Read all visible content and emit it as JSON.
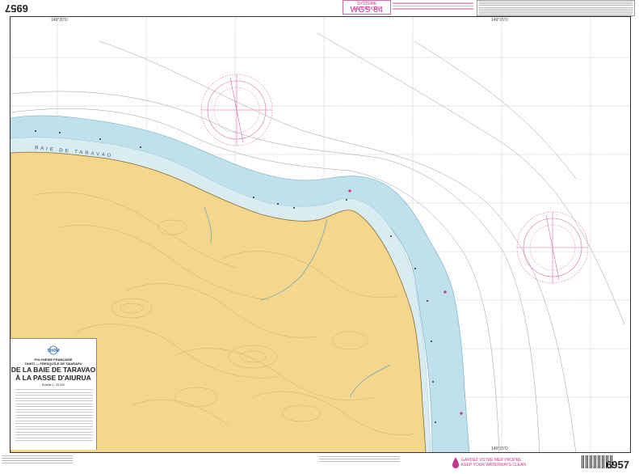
{
  "sheet_number": "6957",
  "datum": {
    "small": "SYSTÈME GÉODÉSIQUE",
    "big": "WGS 84"
  },
  "title": {
    "region": "POLYNÉSIE FRANÇAISE\nTAHITI — PRESQU'ÎLE DE TAIARAPU",
    "main": "DE LA BAIE DE TARAVAO\nÀ LA PASSE D'AIURUA",
    "scale": "Échelle 1 : 25 000",
    "publisher": "SHOM"
  },
  "place_names": {
    "bay": "BAIE  DE  TARAVAO"
  },
  "clean_logo": {
    "line1": "GARDEZ VOTRE MER PROPRE",
    "line2": "KEEP YOUR WATERWAYS CLEAN"
  },
  "longitude_labels": [
    "149°20'O",
    "149°15'O"
  ],
  "colors": {
    "land": "#f4d68c",
    "shallow_water": "#bfe1ec",
    "reef": "#d8ecf2",
    "magenta": "#c2368c",
    "contour": "#c9a25a",
    "stream": "#5aa8c8"
  }
}
